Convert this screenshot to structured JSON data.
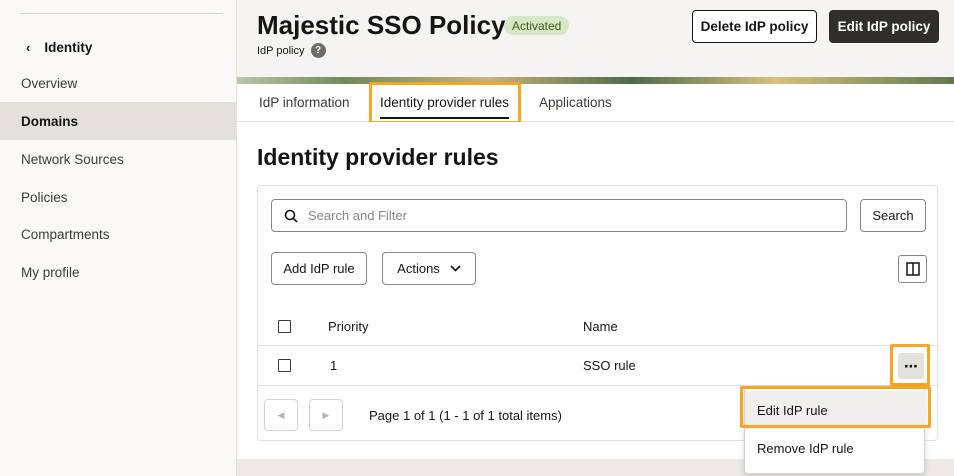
{
  "sidebar": {
    "back_label": "Identity",
    "items": [
      {
        "label": "Overview"
      },
      {
        "label": "Domains"
      },
      {
        "label": "Network Sources"
      },
      {
        "label": "Policies"
      },
      {
        "label": "Compartments"
      },
      {
        "label": "My profile"
      }
    ],
    "active_item": "Domains"
  },
  "header": {
    "title": "Majestic SSO Policy",
    "status_badge": "Activated",
    "subtitle": "IdP policy",
    "delete_button": "Delete IdP policy",
    "edit_button": "Edit IdP policy"
  },
  "tabs": [
    {
      "label": "IdP information"
    },
    {
      "label": "Identity provider rules"
    },
    {
      "label": "Applications"
    }
  ],
  "active_tab": "Identity provider rules",
  "section": {
    "title": "Identity provider rules",
    "search_placeholder": "Search and Filter",
    "search_button": "Search",
    "add_button": "Add IdP rule",
    "actions_button": "Actions"
  },
  "table": {
    "columns": [
      "Priority",
      "Name"
    ],
    "rows": [
      {
        "priority": "1",
        "name": "SSO rule"
      }
    ]
  },
  "pagination": {
    "text": "Page 1 of 1 (1 - 1 of 1 total items)"
  },
  "row_menu": {
    "items": [
      {
        "label": "Edit IdP rule"
      },
      {
        "label": "Remove IdP rule"
      }
    ]
  },
  "colors": {
    "highlight": "#f5a623",
    "badge_bg": "#d4e8c5",
    "primary_dark": "#312d2a",
    "active_nav_bg": "#e4e1dd"
  }
}
